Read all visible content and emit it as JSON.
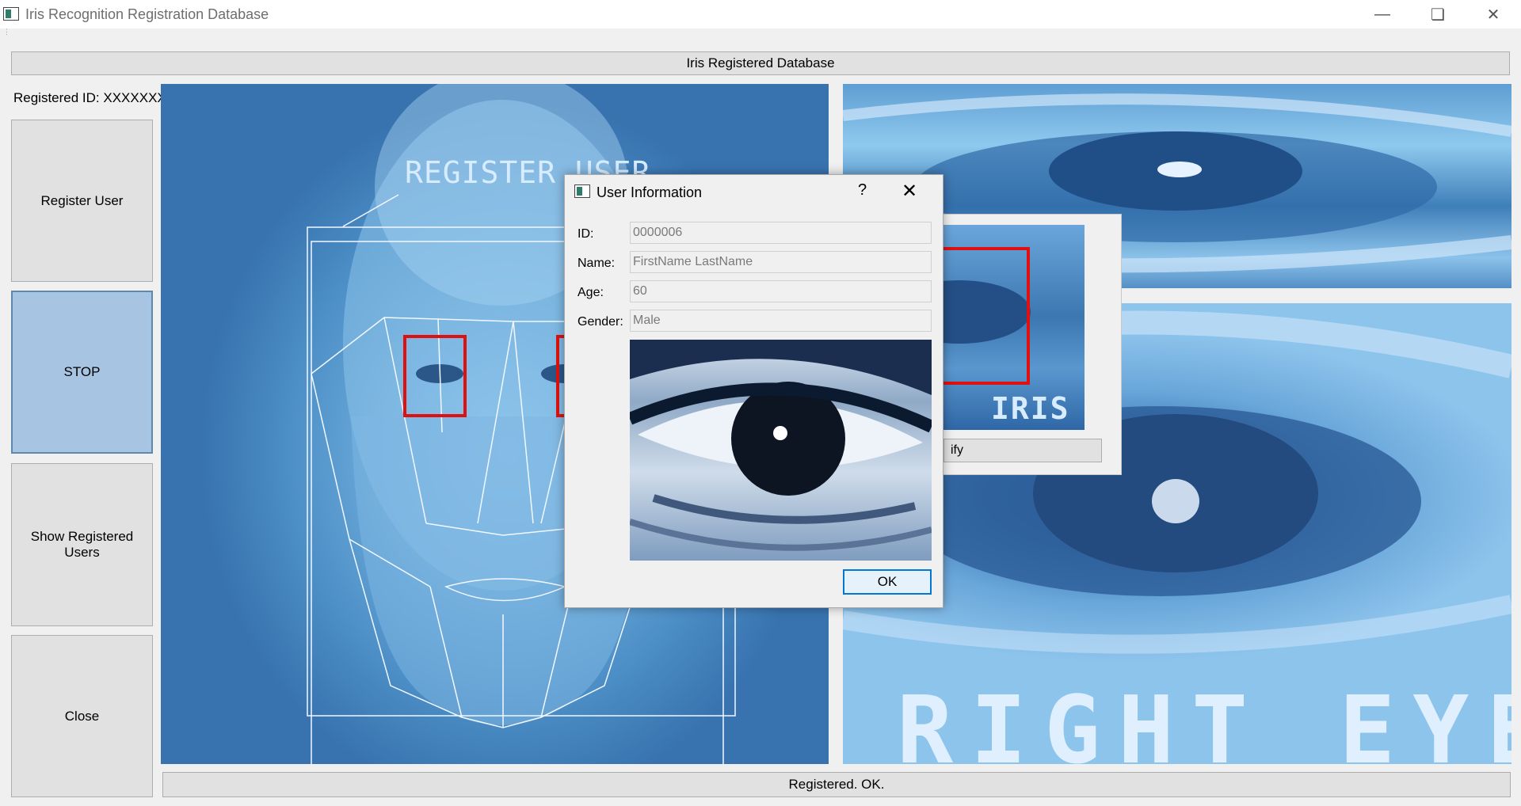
{
  "window": {
    "title": "Iris Recognition Registration Database",
    "minimize_icon": "minimize-icon",
    "restore_icon": "restore-icon",
    "close_icon": "close-icon"
  },
  "header": {
    "label": "Iris Registered Database"
  },
  "sidebar": {
    "registered_id": "Registered ID: XXXXXXX",
    "buttons": [
      {
        "label": "Register User"
      },
      {
        "label": "STOP",
        "active": true
      },
      {
        "label": "Show Registered Users"
      },
      {
        "label": "Close"
      }
    ]
  },
  "face_panel": {
    "overlay_text": "REGISTER USER"
  },
  "right_panel": {
    "overlay_text": "RIGHT EYE"
  },
  "background_dialog": {
    "iris_label": "IRIS",
    "button_label_fragment": "ify"
  },
  "dialog": {
    "title": "User Information",
    "help": "?",
    "close": "✕",
    "fields": [
      {
        "label": "ID:",
        "value": "0000006"
      },
      {
        "label": "Name:",
        "value": "FirstName LastName"
      },
      {
        "label": "Age:",
        "value": "60"
      },
      {
        "label": "Gender:",
        "value": "Male"
      }
    ],
    "ok_label": "OK"
  },
  "status": {
    "text": "Registered. OK."
  },
  "colors": {
    "accent": "#0078d7",
    "stop_button": "#a7c5e2",
    "detection_box": "#e01010",
    "face_background": "#4c8ec6"
  }
}
